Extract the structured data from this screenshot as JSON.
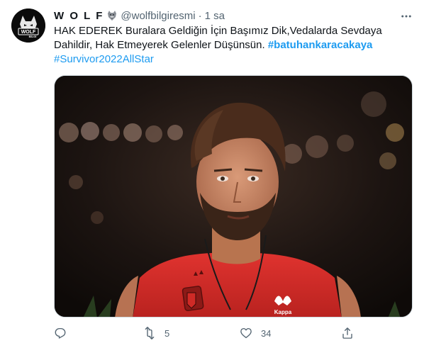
{
  "user": {
    "display_name": "W O L F",
    "name_emoji": "wolf-emoji",
    "handle": "@wolfbilgiresmi",
    "separator": "·",
    "time": "1 sa",
    "avatar_logo_text": "WOLF",
    "avatar_logo_subtext": "BİLGİ"
  },
  "tweet": {
    "text_main": "HAK EDEREK Buralara Geldiğin İçin Başımız Dik,Vedalarda Sevdaya Dahildir, Hak Etmeyerek Gelenler Düşünsün.",
    "hashtag_1": "#batuhankaracakaya",
    "hashtag_2": "#Survivor2022AllStar"
  },
  "media": {
    "description_icon": "photo",
    "shirt_logo_text": "Kappa"
  },
  "actions": {
    "reply_count": "",
    "retweet_count": "5",
    "like_count": "34",
    "share_count": ""
  },
  "colors": {
    "link": "#1d9bf0",
    "secondary_text": "#536471",
    "primary_text": "#0f1419",
    "border": "#cfd9de"
  }
}
